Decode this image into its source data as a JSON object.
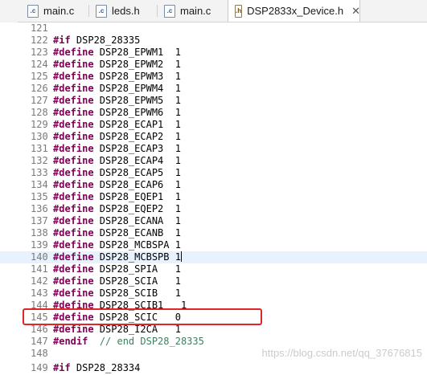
{
  "tabs": [
    {
      "label": "main.c",
      "icon": "c-file-icon"
    },
    {
      "label": "leds.h",
      "icon": "c-file-icon"
    },
    {
      "label": "main.c",
      "icon": "c-file-icon"
    },
    {
      "label": "DSP2833x_Device.h",
      "icon": "h-file-icon",
      "active": true,
      "close": "✕"
    }
  ],
  "code_lines": [
    {
      "n": "121",
      "kw": "",
      "text": ""
    },
    {
      "n": "122",
      "kw": "#if",
      "text": " DSP28_28335"
    },
    {
      "n": "123",
      "kw": "#define",
      "text": " DSP28_EPWM1  1"
    },
    {
      "n": "124",
      "kw": "#define",
      "text": " DSP28_EPWM2  1"
    },
    {
      "n": "125",
      "kw": "#define",
      "text": " DSP28_EPWM3  1"
    },
    {
      "n": "126",
      "kw": "#define",
      "text": " DSP28_EPWM4  1"
    },
    {
      "n": "127",
      "kw": "#define",
      "text": " DSP28_EPWM5  1"
    },
    {
      "n": "128",
      "kw": "#define",
      "text": " DSP28_EPWM6  1"
    },
    {
      "n": "129",
      "kw": "#define",
      "text": " DSP28_ECAP1  1"
    },
    {
      "n": "130",
      "kw": "#define",
      "text": " DSP28_ECAP2  1"
    },
    {
      "n": "131",
      "kw": "#define",
      "text": " DSP28_ECAP3  1"
    },
    {
      "n": "132",
      "kw": "#define",
      "text": " DSP28_ECAP4  1"
    },
    {
      "n": "133",
      "kw": "#define",
      "text": " DSP28_ECAP5  1"
    },
    {
      "n": "134",
      "kw": "#define",
      "text": " DSP28_ECAP6  1"
    },
    {
      "n": "135",
      "kw": "#define",
      "text": " DSP28_EQEP1  1"
    },
    {
      "n": "136",
      "kw": "#define",
      "text": " DSP28_EQEP2  1"
    },
    {
      "n": "137",
      "kw": "#define",
      "text": " DSP28_ECANA  1"
    },
    {
      "n": "138",
      "kw": "#define",
      "text": " DSP28_ECANB  1"
    },
    {
      "n": "139",
      "kw": "#define",
      "text": " DSP28_MCBSPA 1"
    },
    {
      "n": "140",
      "kw": "#define",
      "text": " DSP28_MCBSPB 1",
      "cursor": true
    },
    {
      "n": "141",
      "kw": "#define",
      "text": " DSP28_SPIA   1"
    },
    {
      "n": "142",
      "kw": "#define",
      "text": " DSP28_SCIA   1"
    },
    {
      "n": "143",
      "kw": "#define",
      "text": " DSP28_SCIB   1"
    },
    {
      "n": "144",
      "kw": "#define",
      "text": " DSP28_SCIB1   1"
    },
    {
      "n": "145",
      "kw": "#define",
      "text": " DSP28_SCIC   0"
    },
    {
      "n": "146",
      "kw": "#define",
      "text": " DSP28_I2CA   1"
    },
    {
      "n": "147",
      "kw": "#endif",
      "text": "  ",
      "comment": "// end DSP28_28335"
    },
    {
      "n": "148",
      "kw": "",
      "text": ""
    },
    {
      "n": "149",
      "kw": "#if",
      "text": " DSP28_28334"
    }
  ],
  "highlighted_line": "143",
  "colors": {
    "highlight_box": "#e0262b",
    "keyword": "#7f0055",
    "comment": "#3f7f5f"
  },
  "watermark": "https://blog.csdn.net/qq_37676815"
}
